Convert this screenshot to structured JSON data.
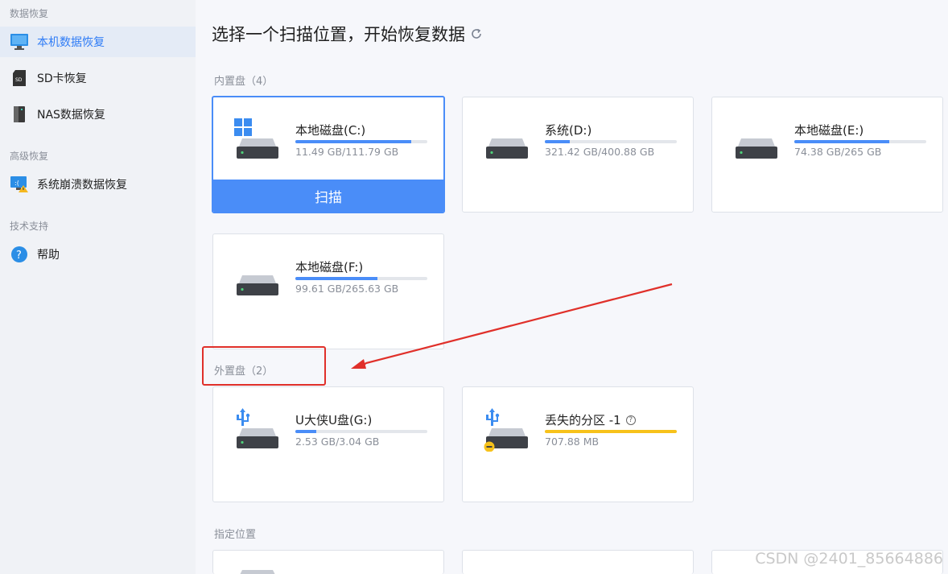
{
  "sidebar": {
    "sections": [
      "数据恢复",
      "高级恢复",
      "技术支持"
    ],
    "items": [
      {
        "label": "本机数据恢复",
        "icon": "monitor-icon"
      },
      {
        "label": "SD卡恢复",
        "icon": "sd-card-icon"
      },
      {
        "label": "NAS数据恢复",
        "icon": "nas-icon"
      },
      {
        "label": "系统崩溃数据恢复",
        "icon": "crash-monitor-icon"
      },
      {
        "label": "帮助",
        "icon": "help-icon"
      }
    ]
  },
  "main": {
    "title": "选择一个扫描位置，开始恢复数据",
    "groups": {
      "internal": "内置盘（4）",
      "external": "外置盘（2）",
      "specified": "指定位置"
    },
    "drives": [
      {
        "name": "本地磁盘(C:)",
        "size": "11.49 GB/111.79 GB",
        "usage": 0.88
      },
      {
        "name": "系统(D:)",
        "size": "321.42 GB/400.88 GB",
        "usage": 0.19
      },
      {
        "name": "本地磁盘(E:)",
        "size": "74.38 GB/265 GB",
        "usage": 0.72
      },
      {
        "name": "本地磁盘(F:)",
        "size": "99.61 GB/265.63 GB",
        "usage": 0.62
      },
      {
        "name": "U大侠U盘(G:)",
        "size": "2.53 GB/3.04 GB",
        "usage": 0.16
      },
      {
        "name": "丢失的分区 -1",
        "size": "707.88 MB",
        "usage": 1.0
      }
    ],
    "scan_label": "扫描"
  },
  "colors": {
    "accent": "#4a8df8",
    "warning": "#f7c21b",
    "annotation": "#e0302a"
  },
  "watermark": "CSDN @2401_85664886"
}
